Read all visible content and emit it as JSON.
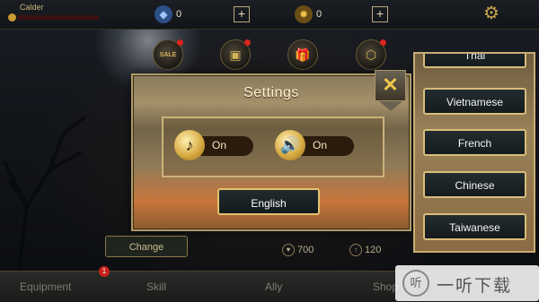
{
  "topbar": {
    "player_name": "Calder",
    "currency_1": {
      "value": "0",
      "icon": "gem-icon"
    },
    "currency_2": {
      "value": "0",
      "icon": "coin-icon"
    },
    "plus": "+"
  },
  "shop_icons": [
    {
      "name": "sale",
      "label": "SALE",
      "icon": "sale-icon"
    },
    {
      "name": "chest",
      "label": "▣",
      "icon": "chest-icon"
    },
    {
      "name": "gift",
      "label": "🎁",
      "icon": "gift-icon"
    },
    {
      "name": "package",
      "label": "⬡",
      "icon": "package-icon"
    }
  ],
  "settings": {
    "title": "Settings",
    "music": {
      "label": "On",
      "icon": "music-note-icon"
    },
    "sound": {
      "label": "On",
      "icon": "speaker-icon"
    },
    "language_button": "English",
    "close": "✕"
  },
  "language_panel": {
    "items": [
      "Thai",
      "Vietnamese",
      "French",
      "Chinese",
      "Taiwanese"
    ]
  },
  "footer": {
    "change_button": "Change",
    "stat_1": "700",
    "stat_2": "120",
    "tabs": [
      "Equipment",
      "Skill",
      "Ally",
      "Shop"
    ],
    "badge": "1"
  },
  "watermark": {
    "text": "一听下载"
  },
  "colors": {
    "accent_gold": "#e2c26f",
    "button_dark": "#182124",
    "alert_red": "#d8251e"
  }
}
